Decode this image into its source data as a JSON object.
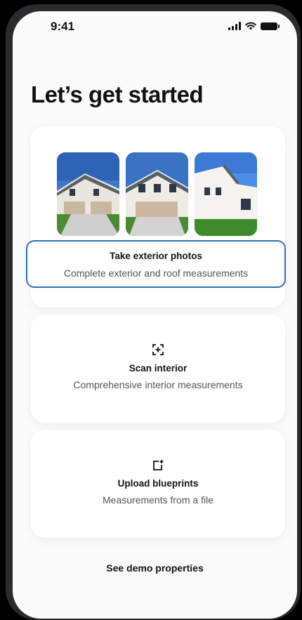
{
  "status_bar": {
    "time": "9:41"
  },
  "page": {
    "title": "Let’s get started"
  },
  "cards": {
    "exterior": {
      "title": "Take exterior photos",
      "subtitle": "Complete exterior and roof measurements"
    },
    "interior": {
      "title": "Scan interior",
      "subtitle": "Comprehensive interior measurements",
      "icon": "scan-icon"
    },
    "blueprints": {
      "title": "Upload blueprints",
      "subtitle": "Measurements from a file",
      "icon": "upload-file-icon"
    }
  },
  "footer": {
    "demo_link": "See demo properties"
  },
  "colors": {
    "accent": "#2f6fb5",
    "background": "#fbfbfb",
    "text": "#111111"
  }
}
